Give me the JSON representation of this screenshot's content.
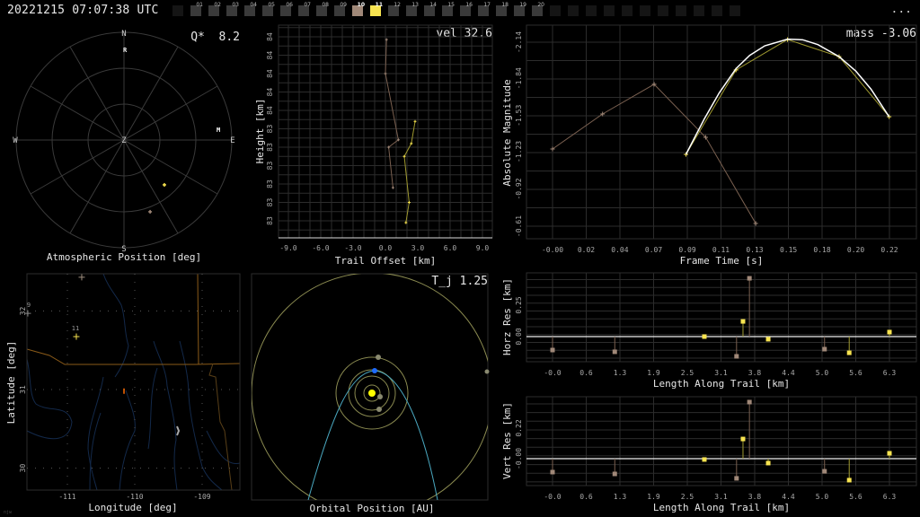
{
  "header": {
    "timestamp": "20221215 07:07:38 UTC",
    "more_label": "...",
    "stations": [
      {
        "label": "",
        "state": "empty"
      },
      {
        "label": "01",
        "state": "inactive"
      },
      {
        "label": "02",
        "state": "inactive"
      },
      {
        "label": "03",
        "state": "inactive"
      },
      {
        "label": "04",
        "state": "inactive"
      },
      {
        "label": "05",
        "state": "inactive"
      },
      {
        "label": "06",
        "state": "inactive"
      },
      {
        "label": "07",
        "state": "inactive"
      },
      {
        "label": "08",
        "state": "inactive"
      },
      {
        "label": "09",
        "state": "inactive"
      },
      {
        "label": "10",
        "state": "s10"
      },
      {
        "label": "11",
        "state": "s11"
      },
      {
        "label": "12",
        "state": "inactive"
      },
      {
        "label": "13",
        "state": "inactive"
      },
      {
        "label": "14",
        "state": "inactive"
      },
      {
        "label": "15",
        "state": "inactive"
      },
      {
        "label": "16",
        "state": "inactive"
      },
      {
        "label": "17",
        "state": "inactive"
      },
      {
        "label": "18",
        "state": "inactive"
      },
      {
        "label": "19",
        "state": "inactive"
      },
      {
        "label": "20",
        "state": "inactive"
      },
      {
        "label": "",
        "state": "empty"
      },
      {
        "label": "",
        "state": "empty"
      },
      {
        "label": "",
        "state": "empty"
      },
      {
        "label": "",
        "state": "empty"
      },
      {
        "label": "",
        "state": "empty"
      },
      {
        "label": "",
        "state": "empty"
      },
      {
        "label": "",
        "state": "empty"
      },
      {
        "label": "",
        "state": "empty"
      },
      {
        "label": "",
        "state": "empty"
      },
      {
        "label": "",
        "state": "empty"
      },
      {
        "label": "",
        "state": "empty"
      }
    ]
  },
  "colors": {
    "station10": "#a08878",
    "station11": "#f8e450",
    "grid": "#2c2c2c",
    "fit": "#ffffff",
    "orbit": "#8a8a50",
    "meteor_orbit": "#4aa8c0",
    "earth": "#1e6cff",
    "sun": "#ffff00"
  },
  "chart_data": [
    {
      "type": "scatter",
      "id": "atmospheric",
      "title": "Atmospheric Position [deg]",
      "annotation": "Q*  8.2",
      "cardinals": {
        "n": "N",
        "s": "S",
        "e": "E",
        "w": "W",
        "z": "Z"
      },
      "markers": [
        {
          "label": "R",
          "az": 0.6,
          "zen": 75.8
        },
        {
          "label": "M",
          "az": 83.5,
          "zen": 79.3
        }
      ],
      "points": [
        {
          "station": "11",
          "az": 138,
          "zen": 50.4
        },
        {
          "station": "10",
          "az": 160,
          "zen": 63.8
        }
      ]
    },
    {
      "type": "line",
      "id": "height",
      "xlabel": "Trail Offset [km]",
      "ylabel": "Height [km]",
      "annotation": "vel 32.6",
      "xlim": [
        -9.9,
        9.9
      ],
      "xticks": [
        {
          "v": -9,
          "l": "-9.0"
        },
        {
          "v": -6,
          "l": "-6.0"
        },
        {
          "v": -3,
          "l": "-3.0"
        },
        {
          "v": 0,
          "l": "0.0"
        },
        {
          "v": 3,
          "l": "3.0"
        },
        {
          "v": 6,
          "l": "6.0"
        },
        {
          "v": 9,
          "l": "9.0"
        }
      ],
      "yticks": [
        {
          "v": 84.0,
          "l": "84"
        },
        {
          "v": 83.9,
          "l": "84"
        },
        {
          "v": 83.8,
          "l": "84"
        },
        {
          "v": 83.7,
          "l": "84"
        },
        {
          "v": 83.6,
          "l": "84"
        },
        {
          "v": 83.5,
          "l": "83"
        },
        {
          "v": 83.4,
          "l": "83"
        },
        {
          "v": 83.3,
          "l": "83"
        },
        {
          "v": 83.2,
          "l": "83"
        },
        {
          "v": 83.1,
          "l": "83"
        },
        {
          "v": 83.0,
          "l": "83"
        }
      ],
      "series": [
        {
          "name": "10",
          "x": [
            0.1,
            0.0,
            1.2,
            0.3,
            0.7
          ],
          "y": [
            83.985,
            83.8,
            83.44,
            83.4,
            83.18
          ]
        },
        {
          "name": "11",
          "x": [
            2.75,
            2.4,
            1.75,
            2.2,
            1.9
          ],
          "y": [
            83.54,
            83.42,
            83.35,
            83.1,
            82.99
          ]
        }
      ]
    },
    {
      "type": "line",
      "id": "magnitude",
      "xlabel": "Frame Time [s]",
      "ylabel": "Absolute Magnitude",
      "annotation": "mass -3.06",
      "xticks": [
        {
          "v": 0,
          "l": "-0.00"
        },
        {
          "v": 0.0222,
          "l": "0.02"
        },
        {
          "v": 0.0444,
          "l": "0.04"
        },
        {
          "v": 0.0667,
          "l": "0.07"
        },
        {
          "v": 0.0889,
          "l": "0.09"
        },
        {
          "v": 0.1111,
          "l": "0.11"
        },
        {
          "v": 0.1333,
          "l": "0.13"
        },
        {
          "v": 0.1556,
          "l": "0.15"
        },
        {
          "v": 0.1778,
          "l": "0.18"
        },
        {
          "v": 0.2,
          "l": "0.20"
        },
        {
          "v": 0.2222,
          "l": "0.22"
        }
      ],
      "yticks": [
        {
          "v": -2.14,
          "l": "-2.14"
        },
        {
          "v": -1.84,
          "l": "-1.84"
        },
        {
          "v": -1.53,
          "l": "-1.53"
        },
        {
          "v": -1.23,
          "l": "-1.23"
        },
        {
          "v": -0.92,
          "l": "-0.92"
        },
        {
          "v": -0.61,
          "l": "-0.61"
        }
      ],
      "series": [
        {
          "name": "10",
          "x": [
            0,
            0.033,
            0.067,
            0.101,
            0.134
          ],
          "y": [
            -1.252,
            -1.543,
            -1.79,
            -1.349,
            -0.633
          ]
        },
        {
          "name": "11",
          "x": [
            0.088,
            0.121,
            0.155,
            0.189,
            0.222
          ],
          "y": [
            -1.207,
            -1.909,
            -2.162,
            -2.02,
            -1.52
          ]
        },
        {
          "name": "fit",
          "x": [
            0.088,
            0.1,
            0.11,
            0.121,
            0.13,
            0.14,
            0.155,
            0.165,
            0.175,
            0.189,
            0.2,
            0.21,
            0.222
          ],
          "y": [
            -1.207,
            -1.5,
            -1.72,
            -1.92,
            -2.03,
            -2.11,
            -2.165,
            -2.16,
            -2.12,
            -2.02,
            -1.9,
            -1.75,
            -1.52
          ]
        }
      ]
    },
    {
      "type": "scatter",
      "id": "horz_res",
      "xlabel": "Length Along Trail [km]",
      "ylabel": "Horz Res [km]",
      "xticks": [
        {
          "v": 0,
          "l": "-0.0"
        },
        {
          "v": 0.628,
          "l": "0.6"
        },
        {
          "v": 1.256,
          "l": "1.3"
        },
        {
          "v": 1.884,
          "l": "1.9"
        },
        {
          "v": 2.512,
          "l": "2.5"
        },
        {
          "v": 3.14,
          "l": "3.1"
        },
        {
          "v": 3.768,
          "l": "3.8"
        },
        {
          "v": 4.396,
          "l": "4.4"
        },
        {
          "v": 5.024,
          "l": "5.0"
        },
        {
          "v": 5.652,
          "l": "5.6"
        },
        {
          "v": 6.28,
          "l": "6.3"
        }
      ],
      "yticks": [
        {
          "v": 0.25,
          "l": "0.25"
        },
        {
          "v": 0.0,
          "l": "0.00"
        }
      ],
      "series": [
        {
          "name": "10",
          "x": [
            0,
            1.16,
            3.43,
            3.67,
            5.07
          ],
          "y": [
            -0.107,
            -0.121,
            -0.157,
            0.464,
            -0.1
          ]
        },
        {
          "name": "11",
          "x": [
            2.83,
            3.55,
            4.02,
            5.53,
            6.28
          ],
          "y": [
            0.0,
            0.121,
            -0.021,
            -0.129,
            0.036
          ]
        }
      ]
    },
    {
      "type": "scatter",
      "id": "vert_res",
      "xlabel": "Length Along Trail [km]",
      "ylabel": "Vert Res [km]",
      "xticks": [
        {
          "v": 0,
          "l": "-0.0"
        },
        {
          "v": 0.628,
          "l": "0.6"
        },
        {
          "v": 1.256,
          "l": "1.3"
        },
        {
          "v": 1.884,
          "l": "1.9"
        },
        {
          "v": 2.512,
          "l": "2.5"
        },
        {
          "v": 3.14,
          "l": "3.1"
        },
        {
          "v": 3.768,
          "l": "3.8"
        },
        {
          "v": 4.396,
          "l": "4.4"
        },
        {
          "v": 5.024,
          "l": "5.0"
        },
        {
          "v": 5.652,
          "l": "5.6"
        },
        {
          "v": 6.28,
          "l": "6.3"
        }
      ],
      "yticks": [
        {
          "v": 0.22,
          "l": "0.22"
        },
        {
          "v": 0.0,
          "l": "-0.00"
        }
      ],
      "series": [
        {
          "name": "10",
          "x": [
            0,
            1.16,
            3.43,
            3.67,
            5.07
          ],
          "y": [
            -0.097,
            -0.11,
            -0.142,
            0.408,
            -0.091
          ]
        },
        {
          "name": "11",
          "x": [
            2.83,
            3.55,
            4.02,
            5.53,
            6.28
          ],
          "y": [
            -0.006,
            0.142,
            -0.032,
            -0.155,
            0.039
          ]
        }
      ]
    },
    {
      "type": "scatter",
      "id": "map",
      "xlabel": "Longitude [deg]",
      "ylabel": "Latitude [deg]",
      "xticks": [
        {
          "v": -111,
          "l": "-111"
        },
        {
          "v": -110,
          "l": "-110"
        },
        {
          "v": -109,
          "l": "-109"
        }
      ],
      "yticks": [
        {
          "v": 32,
          "l": "32"
        },
        {
          "v": 31,
          "l": "31"
        },
        {
          "v": 30,
          "l": "30"
        }
      ],
      "stations": [
        {
          "label": "",
          "lon": -110.787,
          "lat": 32.43,
          "color": "#a09080"
        },
        {
          "label": "9",
          "lon": -111.587,
          "lat": 31.97,
          "color": "#888888"
        },
        {
          "label": "11",
          "lon": -110.867,
          "lat": 31.674,
          "color": "#f8e450"
        }
      ],
      "trail": {
        "lon": -110.16,
        "lat": 30.98
      },
      "corner_label": "njw"
    },
    {
      "type": "scatter",
      "id": "orbit",
      "xlabel": "Orbital Position [AU]",
      "annotation": "T_j 1.25"
    }
  ]
}
